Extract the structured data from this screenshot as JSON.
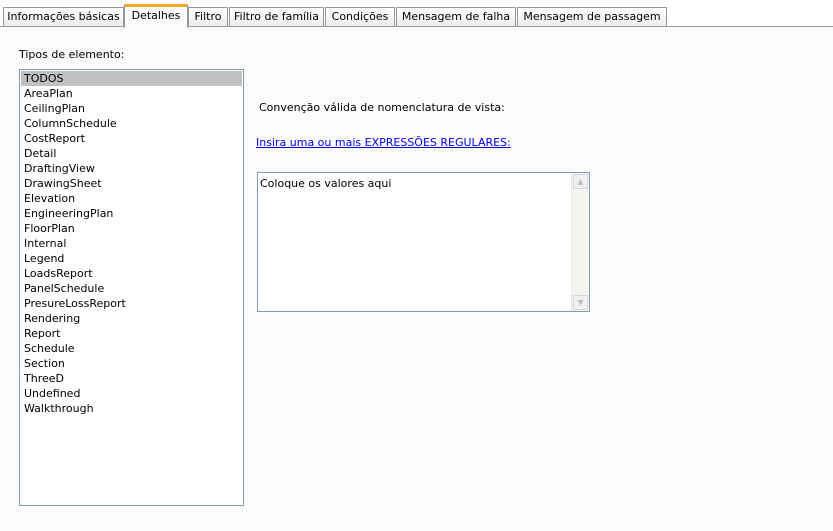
{
  "tabs": [
    {
      "label": "Informações básicas",
      "active": false
    },
    {
      "label": "Detalhes",
      "active": true
    },
    {
      "label": "Filtro",
      "active": false
    },
    {
      "label": "Filtro de família",
      "active": false
    },
    {
      "label": "Condições",
      "active": false
    },
    {
      "label": "Mensagem de falha",
      "active": false
    },
    {
      "label": "Mensagem de passagem",
      "active": false
    }
  ],
  "element_types": {
    "label": "Tipos de elemento:",
    "items": [
      "TODOS",
      "AreaPlan",
      "CeilingPlan",
      "ColumnSchedule",
      "CostReport",
      "Detail",
      "DraftingView",
      "DrawingSheet",
      "Elevation",
      "EngineeringPlan",
      "FloorPlan",
      "Internal",
      "Legend",
      "LoadsReport",
      "PanelSchedule",
      "PresureLossReport",
      "Rendering",
      "Report",
      "Schedule",
      "Section",
      "ThreeD",
      "Undefined",
      "Walkthrough"
    ],
    "selected": "TODOS"
  },
  "naming": {
    "label": "Convenção válida de nomenclatura de vista:",
    "link": "Insira uma ou mais EXPRESSÕES REGULARES:",
    "value": "Coloque os valores aqui"
  },
  "icons": {
    "scroll_up": "scroll-up-arrow-icon",
    "scroll_down": "scroll-down-arrow-icon"
  },
  "colors": {
    "active_tab_accent": "#f0a530",
    "link": "#0000ee",
    "selection": "#c0c0c0"
  }
}
